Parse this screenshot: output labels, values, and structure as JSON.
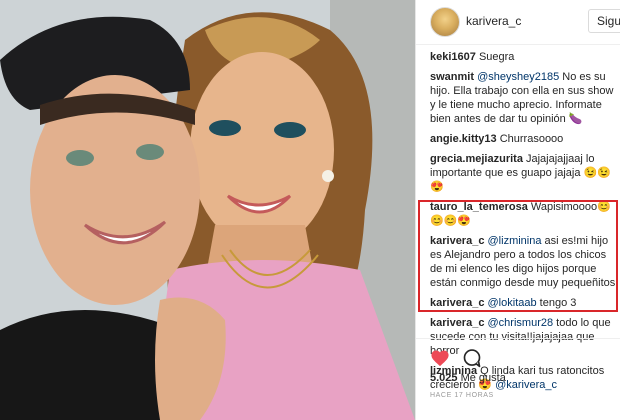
{
  "post": {
    "username": "karivera_c",
    "follow_label": "Sigue",
    "likes_count": "5.025",
    "likes_label": "Me gusta",
    "timestamp": "HACE 17 HORAS"
  },
  "comments": [
    {
      "user": "keki1607",
      "text": " Suegra"
    },
    {
      "user": "swanmit",
      "mention": "@sheyshey2185",
      "text": " No es su hijo. Ella trabajo con ella en sus show y le tiene mucho aprecio. Informate bien antes de dar tu opinión 🍆"
    },
    {
      "user": "angie.kitty13",
      "text": " Churrasoooo"
    },
    {
      "user": "grecia.mejiazurita",
      "text": " Jajajajajjaaj lo importante que es guapo jajaja 😉😉😍"
    },
    {
      "user": "tauro_la_temerosa",
      "text": " Wapisimoooo😊😊😊😍"
    },
    {
      "user": "karivera_c",
      "mention": "@lizminina",
      "text": " asi es!mi hijo es Alejandro pero a todos los chicos de mi elenco les digo hijos porque están conmigo desde muy pequeñitos"
    },
    {
      "user": "karivera_c",
      "mention": "@lokitaab",
      "text": " tengo 3"
    },
    {
      "user": "karivera_c",
      "mention": "@chrismur28",
      "text": " todo lo que sucede con tu visita!!jajajajaa que horror"
    },
    {
      "user": "lizminina",
      "text": " Q linda kari tus ratoncitos crecieron 😍",
      "trailing_mention": "@karivera_c"
    }
  ],
  "icons": {
    "heart": "heart-icon",
    "comment": "comment-icon",
    "avatar": "avatar"
  },
  "colors": {
    "heart": "#ed4956",
    "highlight_border": "#d9262a",
    "mention": "#003569"
  }
}
